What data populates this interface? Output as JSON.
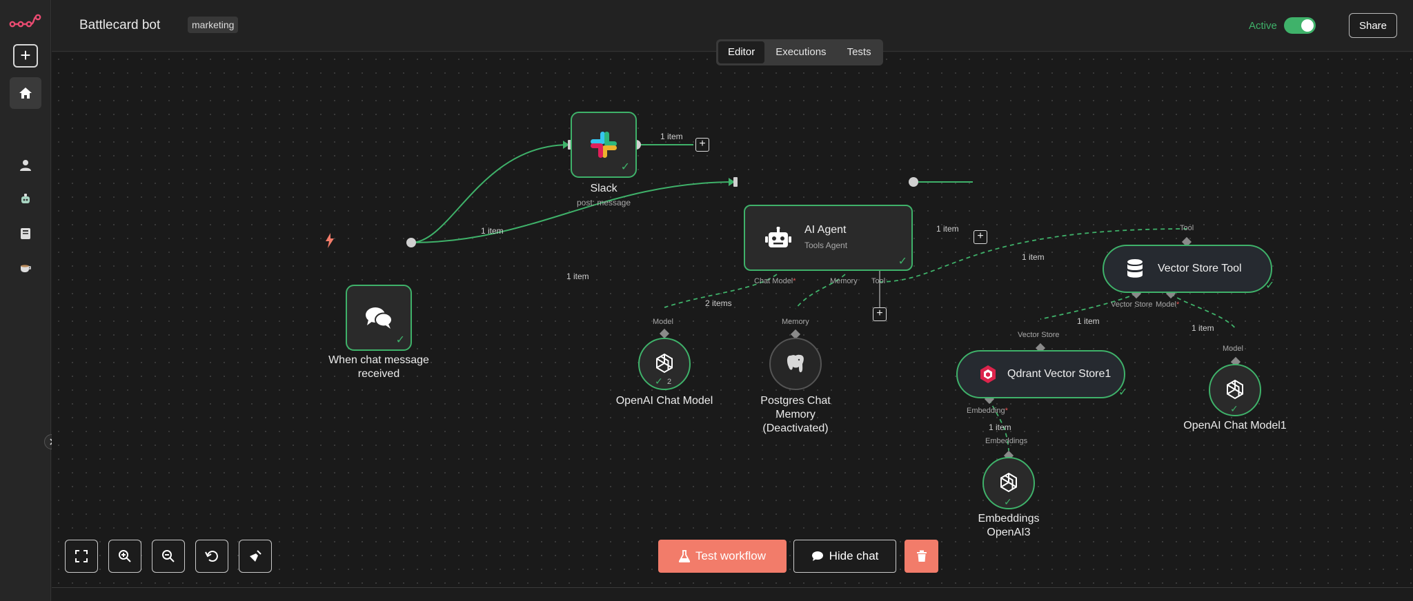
{
  "header": {
    "workflow_name": "Battlecard bot",
    "tag": "marketing",
    "active_label": "Active",
    "share_label": "Share"
  },
  "tabs": [
    {
      "label": "Editor",
      "selected": true
    },
    {
      "label": "Executions",
      "selected": false
    },
    {
      "label": "Tests",
      "selected": false
    }
  ],
  "nodes": {
    "trigger": {
      "label": "When chat message received"
    },
    "slack": {
      "label": "Slack",
      "subtitle": "post: message"
    },
    "agent": {
      "label": "AI Agent",
      "subtitle": "Tools Agent"
    },
    "vector_tool": {
      "label": "Vector Store Tool"
    },
    "openai_chat": {
      "label": "OpenAI Chat Model",
      "badge": "2"
    },
    "postgres": {
      "label_1": "Postgres Chat",
      "label_2": "Memory",
      "label_3": "(Deactivated)"
    },
    "qdrant": {
      "label": "Qdrant Vector Store1"
    },
    "openai_chat1": {
      "label": "OpenAI Chat Model1"
    },
    "embeddings": {
      "label_1": "Embeddings",
      "label_2": "OpenAI3"
    }
  },
  "ports": {
    "chat_model": "Chat Model",
    "memory": "Memory",
    "tool": "Tool",
    "model": "Model",
    "vector_store": "Vector Store",
    "embedding": "Embedding",
    "embeddings": "Embeddings",
    "required_mark": "*"
  },
  "edge_labels": {
    "trigger_slack": "1 item",
    "trigger_agent": "1 item",
    "slack_out": "1 item",
    "agent_out": "1 item",
    "tool_link": "1 item",
    "model_link": "2 items",
    "vs_link": "1 item",
    "model1_link": "1 item",
    "emb_link": "1 item"
  },
  "controls": {
    "test_workflow": "Test workflow",
    "hide_chat": "Hide chat"
  },
  "colors": {
    "success": "#3fb26a",
    "accent": "#f27c6a",
    "slack_red": "#e01e5a",
    "slack_blue": "#36c5f0",
    "slack_green": "#2eb67d",
    "slack_yellow": "#ecb22e",
    "qdrant": "#dc244c"
  },
  "icons": [
    "n8n-logo-icon",
    "plus-icon",
    "home-icon",
    "user-icon",
    "robot-icon",
    "book-icon",
    "coffee-icon",
    "chevron-right-icon",
    "lightning-icon",
    "chat-bubbles-icon",
    "slack-icon",
    "database-icon",
    "openai-icon",
    "postgres-elephant-icon",
    "qdrant-icon",
    "fit-view-icon",
    "zoom-in-icon",
    "zoom-out-icon",
    "undo-icon",
    "broom-icon",
    "flask-icon",
    "chat-icon",
    "trash-icon"
  ]
}
